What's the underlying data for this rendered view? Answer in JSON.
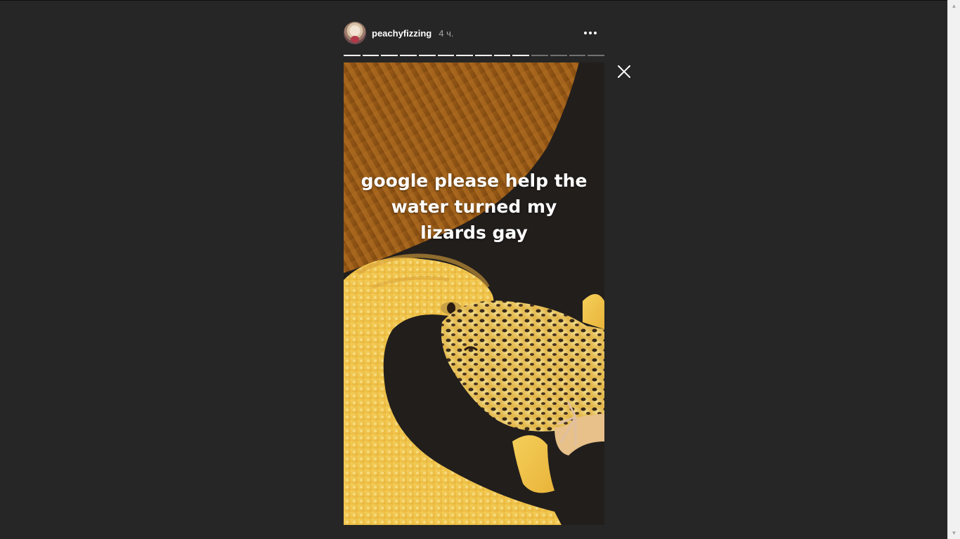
{
  "story": {
    "username": "peachyfizzing",
    "timestamp": "4 ч.",
    "caption": "google please help the water turned my lizards gay",
    "progress": {
      "total_segments": 14,
      "completed_segments": 10
    }
  },
  "icons": {
    "more": "more-options-icon",
    "close": "close-icon",
    "avatar": "avatar"
  },
  "colors": {
    "background": "#262626",
    "text": "#ffffff",
    "muted_text": "#a8a8a8"
  }
}
